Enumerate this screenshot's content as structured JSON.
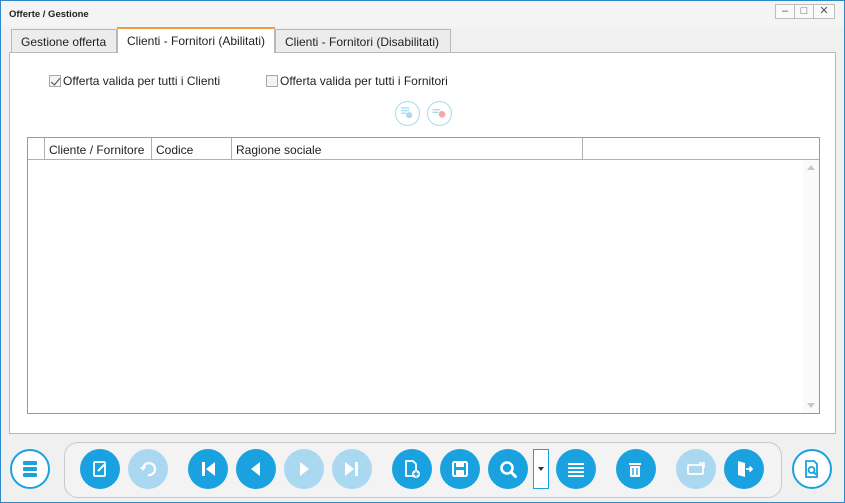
{
  "window": {
    "title": "Offerte / Gestione",
    "controls": [
      "minimize-icon",
      "maximize-icon",
      "close-icon"
    ],
    "accent": "#2d89c8"
  },
  "tabs": [
    {
      "label": "Gestione offerta",
      "active": false
    },
    {
      "label": "Clienti - Fornitori (Abilitati)",
      "active": true
    },
    {
      "label": "Clienti - Fornitori (Disabilitati)",
      "active": false
    }
  ],
  "options": {
    "all_clients": {
      "label": "Offerta valida per tutti i Clienti",
      "checked": true
    },
    "all_suppliers": {
      "label": "Offerta valida per tutti i Fornitori",
      "checked": false
    }
  },
  "grid": {
    "columns": [
      "Cliente / Fornitore",
      "Codice",
      "Ragione sociale"
    ],
    "rows": []
  },
  "toolbar": {
    "button_color": "#1aa1e0",
    "disabled_color": "#aad8f0",
    "buttons": [
      "menu-icon",
      "edit-icon",
      "undo-icon",
      "first-record-icon",
      "previous-record-icon",
      "next-record-icon",
      "last-record-icon",
      "new-document-icon",
      "save-icon",
      "search-icon",
      "list-icon",
      "delete-icon",
      "print-icon",
      "exit-icon",
      "preview-icon"
    ]
  }
}
